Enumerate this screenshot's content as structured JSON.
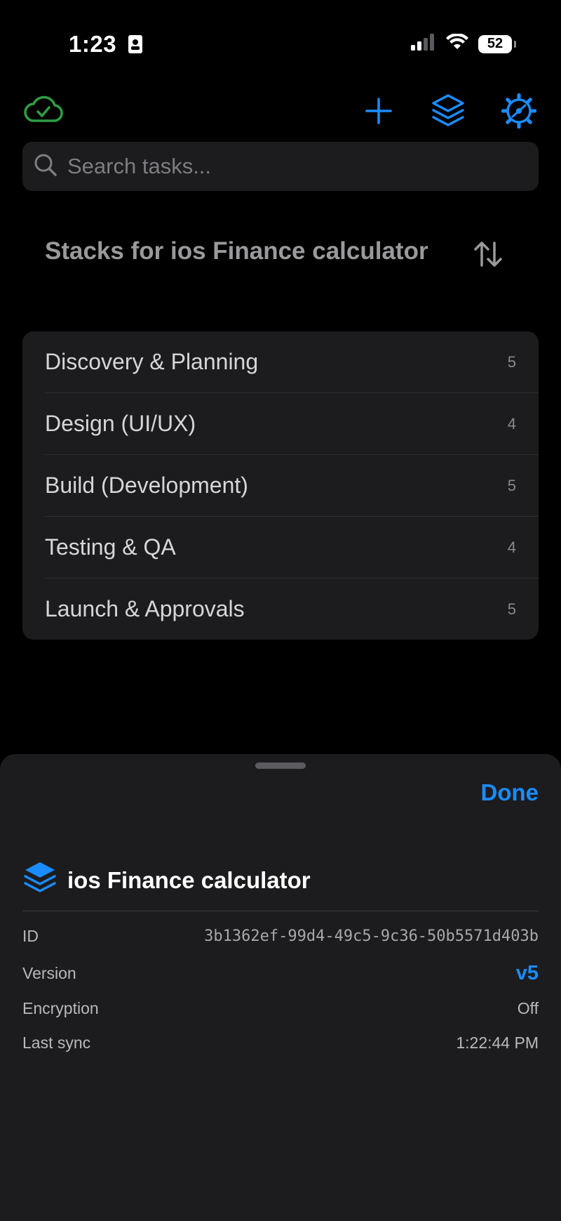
{
  "status_bar": {
    "time": "1:23",
    "battery": "52"
  },
  "toolbar": {
    "sync_icon": "cloud-check-icon",
    "add_icon": "plus-icon",
    "stacks_icon": "layers-icon",
    "settings_icon": "gear-icon"
  },
  "search": {
    "placeholder": "Search tasks..."
  },
  "heading": {
    "title": "Stacks for ios Finance calculator",
    "sort_icon": "sort-arrows-icon"
  },
  "stacks": [
    {
      "name": "Discovery & Planning",
      "count": "5"
    },
    {
      "name": "Design (UI/UX)",
      "count": "4"
    },
    {
      "name": "Build (Development)",
      "count": "5"
    },
    {
      "name": "Testing & QA",
      "count": "4"
    },
    {
      "name": "Launch & Approvals",
      "count": "5"
    }
  ],
  "sheet": {
    "done_label": "Done",
    "project_name": "ios Finance calculator",
    "rows": {
      "id": {
        "label": "ID",
        "value": "3b1362ef-99d4-49c5-9c36-50b5571d403b"
      },
      "version": {
        "label": "Version",
        "value": "v5"
      },
      "encryption": {
        "label": "Encryption",
        "value": "Off"
      },
      "last_sync": {
        "label": "Last sync",
        "value": "1:22:44 PM"
      }
    }
  },
  "colors": {
    "accent": "#1a8cff",
    "sync_green": "#2e9e46",
    "background": "#000000",
    "surface": "#1c1c1e"
  }
}
